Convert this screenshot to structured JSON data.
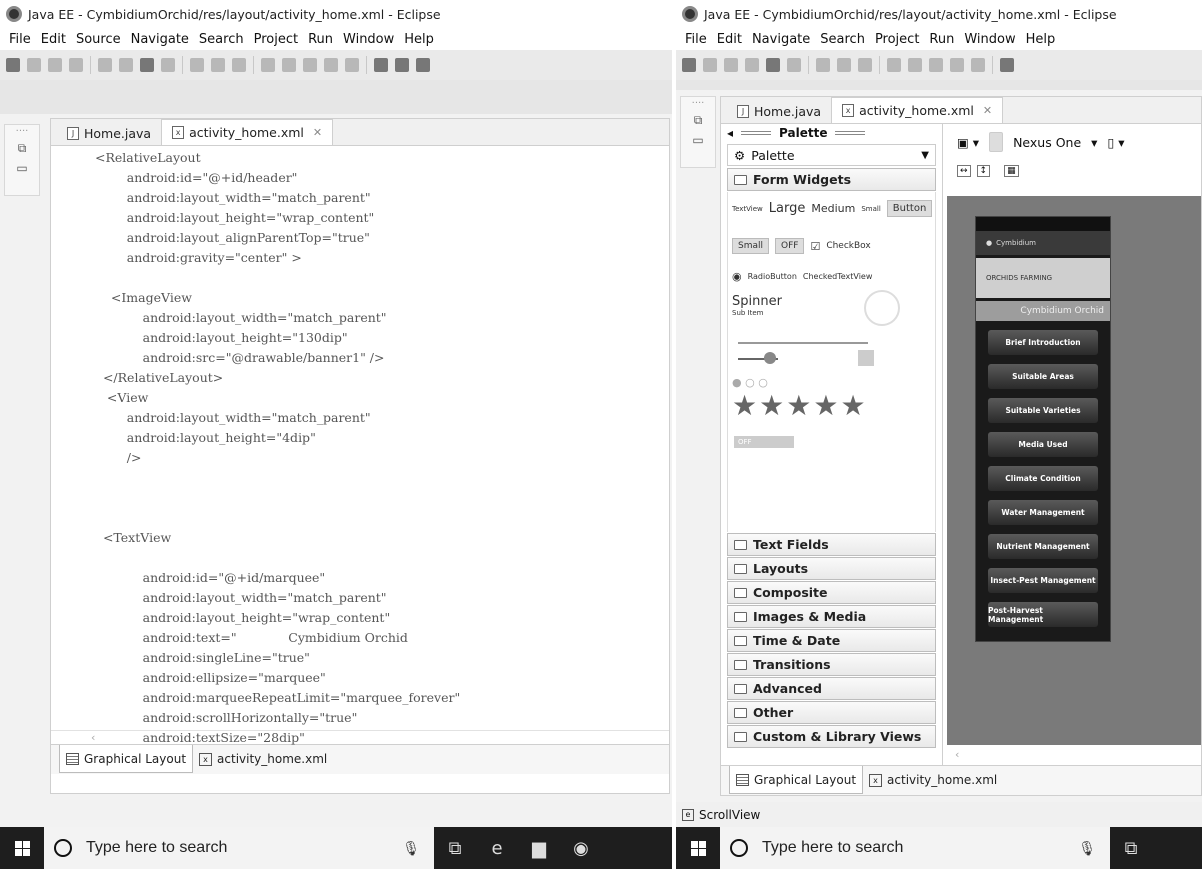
{
  "left": {
    "title": "Java EE - CymbidiumOrchid/res/layout/activity_home.xml - Eclipse",
    "menu": [
      "File",
      "Edit",
      "Source",
      "Navigate",
      "Search",
      "Project",
      "Run",
      "Window",
      "Help"
    ],
    "tabs": {
      "home": "Home.java",
      "xml": "activity_home.xml"
    },
    "code": [
      "<RelativeLayout",
      "        android:id=\"@+id/header\"",
      "        android:layout_width=\"match_parent\"",
      "        android:layout_height=\"wrap_content\"",
      "        android:layout_alignParentTop=\"true\"",
      "        android:gravity=\"center\" >",
      "",
      "    <ImageView",
      "            android:layout_width=\"match_parent\"",
      "            android:layout_height=\"130dip\"",
      "            android:src=\"@drawable/banner1\" />",
      "  </RelativeLayout>",
      "   <View",
      "        android:layout_width=\"match_parent\"",
      "        android:layout_height=\"4dip\"",
      "        />",
      "",
      "",
      "",
      "  <TextView",
      "",
      "            android:id=\"@+id/marquee\"",
      "            android:layout_width=\"match_parent\"",
      "            android:layout_height=\"wrap_content\"",
      "            android:text=\"             Cymbidium Orchid",
      "            android:singleLine=\"true\"",
      "            android:ellipsize=\"marquee\"",
      "            android:marqueeRepeatLimit=\"marquee_forever\"",
      "            android:scrollHorizontally=\"true\"",
      "            android:textSize=\"28dip\"",
      "            android:gravity=\"center\""
    ],
    "bottom_tabs": {
      "graphical": "Graphical Layout",
      "xml": "activity_home.xml"
    },
    "taskbar_search": "Type here to search"
  },
  "right": {
    "title": "Java EE - CymbidiumOrchid/res/layout/activity_home.xml - Eclipse",
    "menu": [
      "File",
      "Edit",
      "Navigate",
      "Search",
      "Project",
      "Run",
      "Window",
      "Help"
    ],
    "tabs": {
      "home": "Home.java",
      "xml": "activity_home.xml"
    },
    "palette": {
      "header": "Palette",
      "dropdown": "Palette",
      "open_category": "Form Widgets",
      "widgets": {
        "textview": "TextView",
        "large": "Large",
        "medium": "Medium",
        "small_text": "Small",
        "button": "Button",
        "small_btn": "Small",
        "off": "OFF",
        "checkbox": "CheckBox",
        "radio": "RadioButton",
        "checked": "CheckedTextView",
        "spinner": "Spinner",
        "subitem": "Sub Item",
        "toggle_off": "OFF"
      },
      "categories": [
        "Text Fields",
        "Layouts",
        "Composite",
        "Images & Media",
        "Time & Date",
        "Transitions",
        "Advanced",
        "Other",
        "Custom & Library Views"
      ]
    },
    "device": "Nexus One",
    "phone": {
      "app_title": "Cymbidium",
      "banner": "ORCHIDS FARMING",
      "marquee": "Cymbidium Orchid",
      "buttons": [
        "Brief Introduction",
        "Suitable Areas",
        "Suitable Varieties",
        "Media Used",
        "Climate Condition",
        "Water Management",
        "Nutrient Management",
        "Insect-Pest Management",
        "Post-Harvest Management"
      ]
    },
    "bottom_tabs": {
      "graphical": "Graphical Layout",
      "xml": "activity_home.xml"
    },
    "status": "ScrollView",
    "taskbar_search": "Type here to search"
  }
}
